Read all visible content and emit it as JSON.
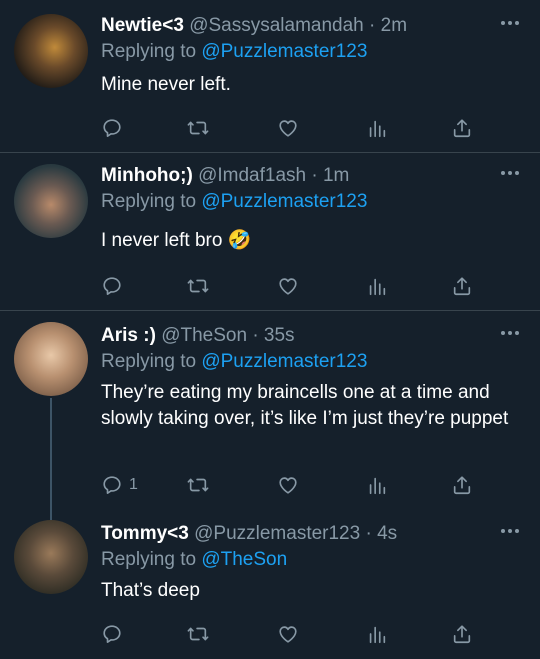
{
  "tweets": [
    {
      "name": "Newtie<3",
      "handle": "@Sassysalamandah",
      "dot": "·",
      "time": "2m",
      "replying_prefix": "Replying to ",
      "replying_to": "@Puzzlemaster123",
      "text": "Mine never left.",
      "reply_count": ""
    },
    {
      "name": "Minhoho;)",
      "handle": "@Imdaf1ash",
      "dot": "·",
      "time": "1m",
      "replying_prefix": "Replying to ",
      "replying_to": "@Puzzlemaster123",
      "text": "I never left bro 🤣",
      "reply_count": ""
    },
    {
      "name": "Aris :)",
      "handle": "@TheSon",
      "dot": "·",
      "time": "35s",
      "replying_prefix": "Replying to ",
      "replying_to": "@Puzzlemaster123",
      "text": "They’re eating my braincells one at a time and slowly taking over, it’s like I’m just they’re puppet",
      "reply_count": "1"
    },
    {
      "name": "Tommy<3",
      "handle": "@Puzzlemaster123",
      "dot": "·",
      "time": "4s",
      "replying_prefix": "Replying to ",
      "replying_to": "@TheSon",
      "text": "That’s deep",
      "reply_count": ""
    }
  ],
  "colors": {
    "background": "#15202b",
    "secondary_text": "#8899a6",
    "mention": "#1da1f2",
    "divider": "#38444d"
  },
  "icons": [
    "reply-icon",
    "retweet-icon",
    "like-icon",
    "analytics-icon",
    "share-icon",
    "more-icon"
  ]
}
